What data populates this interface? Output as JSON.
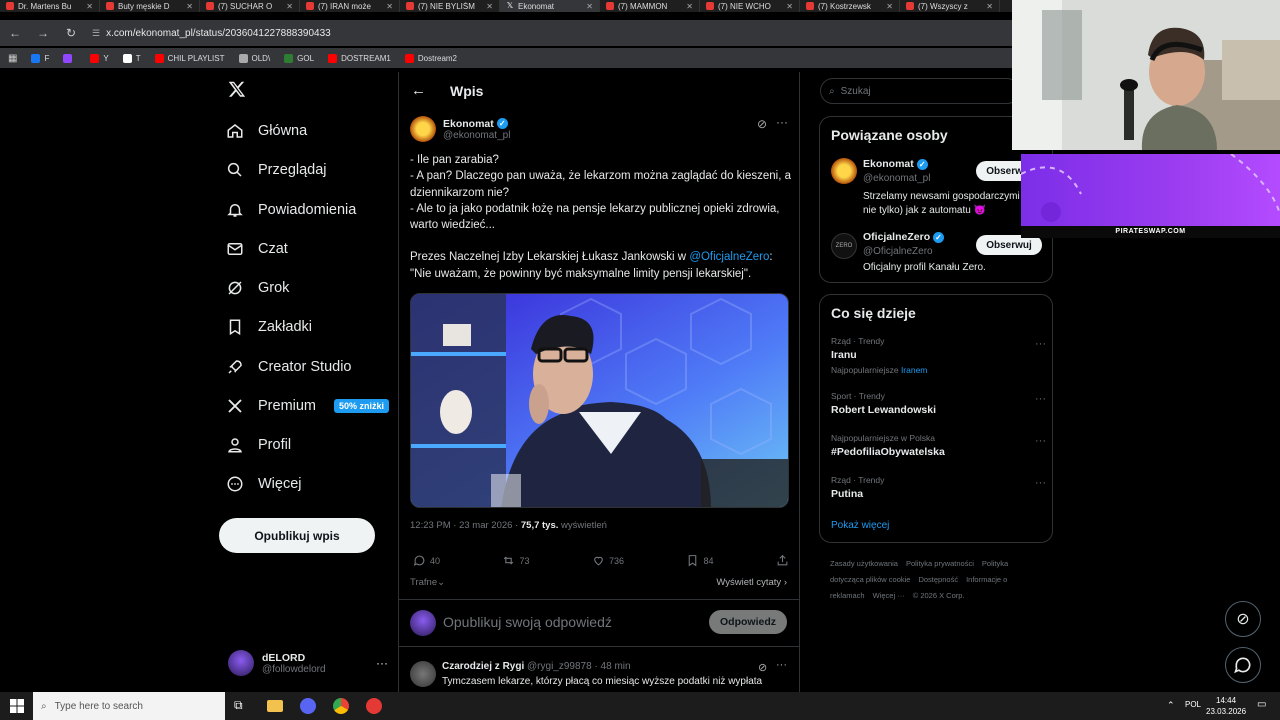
{
  "browser": {
    "tabs": [
      {
        "label": "Dr. Martens Bu",
        "active": false
      },
      {
        "label": "Buty męskie D",
        "active": false
      },
      {
        "label": "(7) SUCHAR O",
        "active": false
      },
      {
        "label": "(7) IRAN może",
        "active": false
      },
      {
        "label": "(7) NIE BYLIŚM",
        "active": false
      },
      {
        "label": "Ekonomat",
        "active": true
      },
      {
        "label": "(7) MAMMON",
        "active": false
      },
      {
        "label": "(7) NIE WCHO",
        "active": false
      },
      {
        "label": "(7) Kostrzewsk",
        "active": false
      },
      {
        "label": "(7) Wszyscy z",
        "active": false
      }
    ],
    "url": "x.com/ekonomat_pl/status/2036041227888390433",
    "bookmarks": [
      {
        "label": "F",
        "color": "#1877f2"
      },
      {
        "label": "",
        "color": "#9146ff"
      },
      {
        "label": "Y",
        "color": "#ff0000"
      },
      {
        "label": "T",
        "color": "#ffffff"
      },
      {
        "label": "CHIL PLAYLIST",
        "color": "#ff0000"
      },
      {
        "label": "OLD\\",
        "color": "#aaaaaa"
      },
      {
        "label": "GOL",
        "color": "#2e7d32"
      },
      {
        "label": "DOSTREAM1",
        "color": "#ff0000"
      },
      {
        "label": "Dostream2",
        "color": "#ff0000"
      }
    ]
  },
  "nav": {
    "items": [
      {
        "label": "Główna",
        "icon": "home-icon"
      },
      {
        "label": "Przeglądaj",
        "icon": "search-icon"
      },
      {
        "label": "Powiadomienia",
        "icon": "bell-icon"
      },
      {
        "label": "Czat",
        "icon": "mail-icon"
      },
      {
        "label": "Grok",
        "icon": "grok-icon"
      },
      {
        "label": "Zakładki",
        "icon": "bookmark-icon"
      },
      {
        "label": "Creator Studio",
        "icon": "rocket-icon"
      },
      {
        "label": "Premium",
        "icon": "x-logo-icon"
      },
      {
        "label": "Profil",
        "icon": "person-icon"
      },
      {
        "label": "Więcej",
        "icon": "more-icon"
      }
    ],
    "premium_badge": "50% zniżki",
    "post_button": "Opublikuj wpis",
    "account_name": "dELORD",
    "account_handle": "@followdelord"
  },
  "post": {
    "header_title": "Wpis",
    "author_name": "Ekonomat",
    "author_handle": "@ekonomat_pl",
    "lines": [
      "- Ile pan zarabia?",
      "- A pan? Dlaczego pan uważa, że lekarzom można zaglądać do kieszeni, a dziennikarzom nie?",
      "- Ale to ja jako podatnik łożę na pensje lekarzy publicznej opieki zdrowia, warto wiedzieć..."
    ],
    "para2_before": "Prezes Naczelnej Izby Lekarskiej Łukasz Jankowski w ",
    "para2_mention": "@OficjalneZero",
    "para2_after": ":",
    "para2_quote": "\"Nie uważam, że powinny być maksymalne limity pensji lekarskiej\".",
    "time": "12:23 PM · 23 mar 2026 · ",
    "views_value": "75,7 tys.",
    "views_label": " wyświetleń",
    "replies": "40",
    "reposts": "73",
    "likes": "736",
    "bookmarks": "84",
    "sort_label": "Trafne",
    "show_quotes": "Wyświetl cytaty",
    "reply_placeholder": "Opublikuj swoją odpowiedź",
    "reply_button": "Odpowiedz",
    "reply_author": "Czarodziej z Rygi",
    "reply_handle": "@rygi_z99878 · 48 min",
    "reply_text": "Tymczasem lekarze, którzy płacą co miesiąc wyższe podatki niż wypłata"
  },
  "right": {
    "search_placeholder": "Szukaj",
    "related_title": "Powiązane osoby",
    "people": [
      {
        "name": "Ekonomat",
        "handle": "@ekonomat_pl",
        "bio": "Strzelamy newsami gospodarczymi nie tylko) jak z automatu 😈",
        "button": "Obserwuj"
      },
      {
        "name": "OficjalneZero",
        "handle": "@OficjalneZero",
        "bio": "Oficjalny profil Kanału Zero.",
        "button": "Obserwuj"
      }
    ],
    "trending_title": "Co się dzieje",
    "trends": [
      {
        "category": "Rząd · Trendy",
        "name": "Iranu",
        "extra_prefix": "Najpopularniejsze ",
        "extra_link": "Iranem"
      },
      {
        "category": "Sport · Trendy",
        "name": "Robert Lewandowski"
      },
      {
        "category": "Najpopularniejsze w Polska",
        "name": "#PedofiliaObywatelska"
      },
      {
        "category": "Rząd · Trendy",
        "name": "Putina"
      }
    ],
    "show_more": "Pokaż więcej",
    "footer": [
      "Zasady użytkowania",
      "Polityka prywatności",
      "Polityka dotycząca plików cookie",
      "Dostępność",
      "Informacje o reklamach",
      "Więcej ···",
      "© 2026 X Corp."
    ]
  },
  "overlay": {
    "promo_site": "PIRATESWAP.COM"
  },
  "taskbar": {
    "search_placeholder": "Type here to search",
    "lang": "POL",
    "time": "14:44",
    "date": "23.03.2026"
  }
}
